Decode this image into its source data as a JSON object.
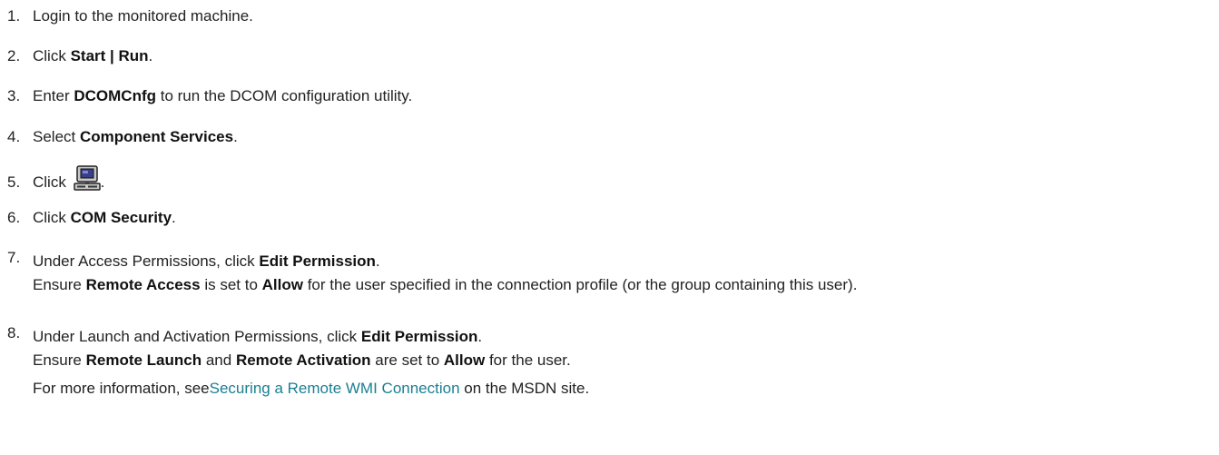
{
  "steps": [
    {
      "num": "1.",
      "text": "Login to the monitored machine."
    },
    {
      "num": "2.",
      "pre": "Click ",
      "bold": "Start | Run",
      "post": "."
    },
    {
      "num": "3.",
      "pre": "Enter ",
      "bold": "DCOMCnfg",
      "post": " to run the DCOM configuration utility."
    },
    {
      "num": "4.",
      "pre": "Select ",
      "bold": "Component Services",
      "post": "."
    },
    {
      "num": "5.",
      "pre": "Click ",
      "icon": "my-computer-icon",
      "post": "."
    },
    {
      "num": "6.",
      "pre": "Click ",
      "bold": "COM Security",
      "post": "."
    },
    {
      "num": "7.",
      "pre": "Under Access Permissions, click ",
      "bold": "Edit Permission",
      "post": ".",
      "detail": {
        "t1": "Ensure ",
        "b1": "Remote Access",
        "t2": " is set to ",
        "b2": "Allow",
        "t3": " for the user specified in the connection profile (or the group containing this user)."
      }
    },
    {
      "num": "8.",
      "pre": "Under Launch and Activation Permissions, click ",
      "bold": "Edit Permission",
      "post": ".",
      "detail": {
        "t1": "Ensure ",
        "b1": "Remote Launch",
        "t2": " and ",
        "b2": "Remote Activation",
        "t3": " are set to ",
        "b3": "Allow",
        "t4": " for the user."
      },
      "more": {
        "pre": "For more information, see",
        "link": "Securing a Remote WMI Connection",
        "post": " on the MSDN site."
      }
    }
  ]
}
